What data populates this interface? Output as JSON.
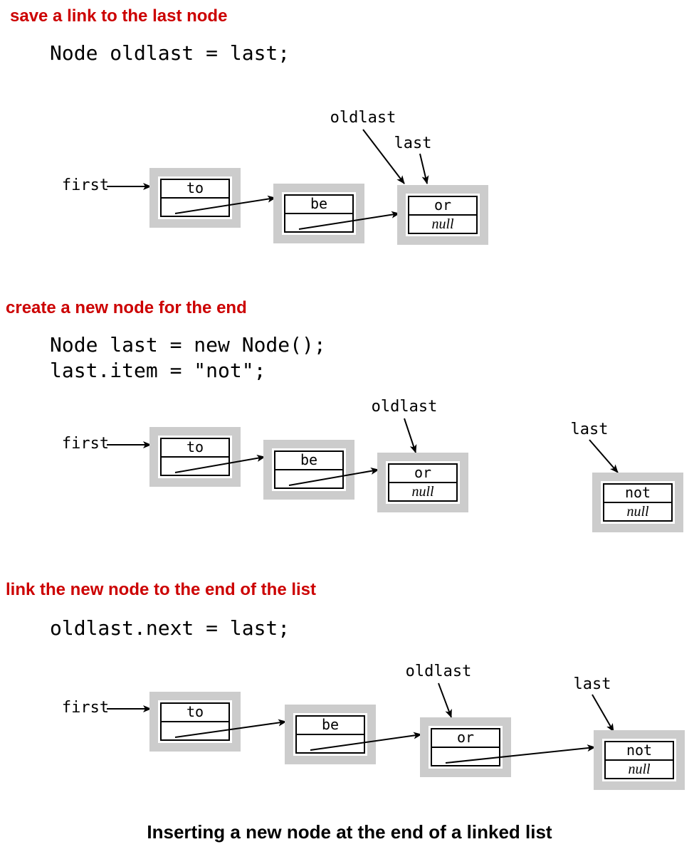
{
  "caption": "Inserting a new node at the end of a linked list",
  "steps": [
    {
      "header": "save a link to the last node",
      "code": [
        "Node oldlast = last;"
      ]
    },
    {
      "header": "create a new node for the end",
      "code": [
        "Node last = new Node();",
        "last.item = \"not\";"
      ]
    },
    {
      "header": "link the new node to the end of the list",
      "code": [
        "oldlast.next = last;"
      ]
    }
  ],
  "labels": {
    "first": "first",
    "oldlast": "oldlast",
    "last": "last",
    "null": "null"
  },
  "nodes": {
    "n1": "to",
    "n2": "be",
    "n3": "or",
    "n4": "not"
  }
}
